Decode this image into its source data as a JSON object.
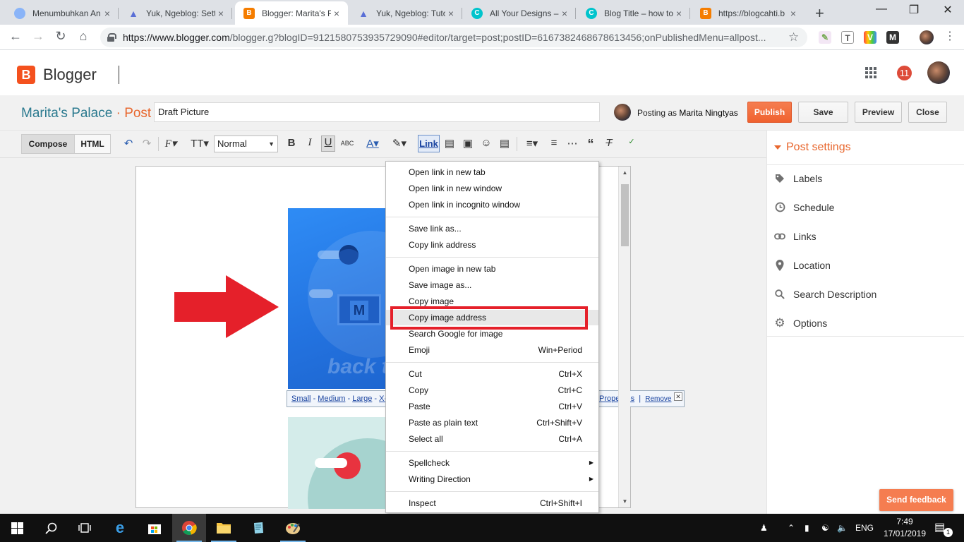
{
  "browser": {
    "tabs": [
      {
        "title": "Menumbuhkan An",
        "icon": "globe-favicon"
      },
      {
        "title": "Yuk, Ngeblog: Sett",
        "icon": "yuk-favicon"
      },
      {
        "title": "Blogger: Marita's P",
        "icon": "blogger-favicon",
        "active": true
      },
      {
        "title": "Yuk, Ngeblog: Tuto",
        "icon": "yuk-favicon"
      },
      {
        "title": "All Your Designs –",
        "icon": "canva-favicon"
      },
      {
        "title": "Blog Title – how to",
        "icon": "canva-favicon"
      },
      {
        "title": "https://blogcahti.b",
        "icon": "blogger-favicon"
      }
    ],
    "url_host": "https://www.blogger.com",
    "url_path": "/blogger.g?blogID=9121580753935729090#editor/target=post;postID=6167382468678613456;onPublishedMenu=allpost..."
  },
  "header": {
    "app_name": "Blogger",
    "notification_count": "11"
  },
  "post": {
    "blog_name": "Marita's Palace",
    "separator": " · ",
    "section": "Post",
    "title_value": "Draft Picture",
    "posting_as_label": "Posting as",
    "author": "Marita Ningtyas",
    "buttons": {
      "publish": "Publish",
      "save": "Save",
      "preview": "Preview",
      "close": "Close"
    }
  },
  "editor": {
    "mode_compose": "Compose",
    "mode_html": "HTML",
    "font_size": "Normal",
    "link_button": "Link",
    "image_text": "back to",
    "image_bar": {
      "sizes": [
        "Small",
        "Medium",
        "Large",
        "X-L"
      ],
      "properties": "Properties",
      "remove": "Remove"
    }
  },
  "context_menu": {
    "groups": [
      [
        {
          "label": "Open link in new tab"
        },
        {
          "label": "Open link in new window"
        },
        {
          "label": "Open link in incognito window"
        }
      ],
      [
        {
          "label": "Save link as..."
        },
        {
          "label": "Copy link address"
        }
      ],
      [
        {
          "label": "Open image in new tab"
        },
        {
          "label": "Save image as..."
        },
        {
          "label": "Copy image"
        },
        {
          "label": "Copy image address",
          "highlighted": true
        },
        {
          "label": "Search Google for image"
        },
        {
          "label": "Emoji",
          "shortcut": "Win+Period"
        }
      ],
      [
        {
          "label": "Cut",
          "shortcut": "Ctrl+X"
        },
        {
          "label": "Copy",
          "shortcut": "Ctrl+C"
        },
        {
          "label": "Paste",
          "shortcut": "Ctrl+V"
        },
        {
          "label": "Paste as plain text",
          "shortcut": "Ctrl+Shift+V"
        },
        {
          "label": "Select all",
          "shortcut": "Ctrl+A"
        }
      ],
      [
        {
          "label": "Spellcheck",
          "submenu": true
        },
        {
          "label": "Writing Direction",
          "submenu": true
        }
      ],
      [
        {
          "label": "Inspect",
          "shortcut": "Ctrl+Shift+I"
        }
      ]
    ],
    "highlight_color": "#e5202a"
  },
  "sidebar": {
    "heading": "Post settings",
    "items": [
      {
        "label": "Labels",
        "icon": "tag-icon"
      },
      {
        "label": "Schedule",
        "icon": "clock-icon"
      },
      {
        "label": "Links",
        "icon": "link-icon"
      },
      {
        "label": "Location",
        "icon": "location-pin-icon"
      },
      {
        "label": "Search Description",
        "icon": "search-icon"
      },
      {
        "label": "Options",
        "icon": "gear-icon"
      }
    ],
    "feedback": "Send feedback"
  },
  "taskbar": {
    "language": "ENG",
    "time": "7:49",
    "date": "17/01/2019",
    "notification_badge": "1"
  },
  "colors": {
    "blogger_orange": "#f4511e",
    "accent_orange": "#e8672e",
    "blog_title_teal": "#2b7a8f",
    "arrow_red": "#e5202a"
  }
}
